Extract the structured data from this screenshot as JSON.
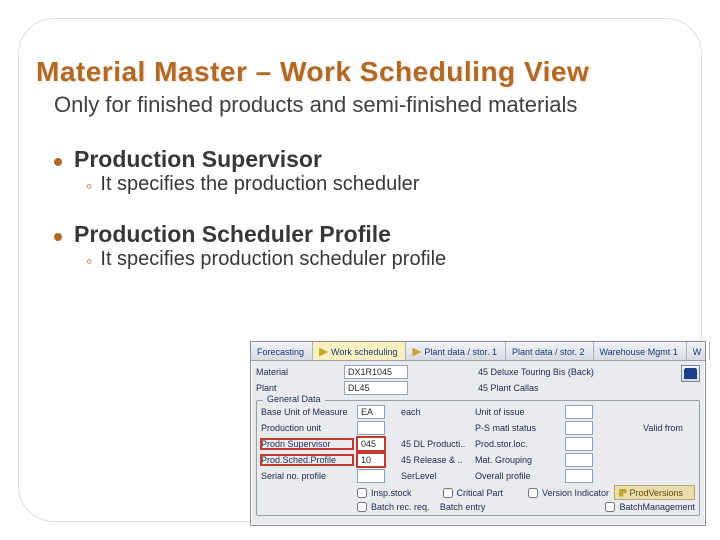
{
  "title": "Material Master – Work Scheduling View",
  "subtitle": "Only for finished products and semi-finished materials",
  "bullets": [
    {
      "heading": "Production Supervisor",
      "sub": "It specifies the production scheduler"
    },
    {
      "heading": "Production Scheduler Profile",
      "sub": "It specifies production scheduler profile"
    }
  ],
  "sap": {
    "tabs": [
      "Forecasting",
      "Work scheduling",
      "Plant data / stor. 1",
      "Plant data / stor. 2",
      "Warehouse Mgmt 1",
      "W"
    ],
    "header": {
      "material_lbl": "Material",
      "material_val": "DX1R1045",
      "material_desc": "45 Deluxe Touring Bis (Back)",
      "plant_lbl": "Plant",
      "plant_val": "DL45",
      "plant_desc": "45 Plant Callas"
    },
    "general": {
      "title": "General Data",
      "rows": {
        "buom_lbl": "Base Unit of Measure",
        "buom_val": "EA",
        "buom_desc": "each",
        "uoi_lbl": "Unit of issue",
        "produnit_lbl": "Production unit",
        "psmat_lbl": "P-S matl status",
        "valid_lbl": "Valid from",
        "supv_lbl": "Prodn Supervisor",
        "supv_val": "045",
        "supv_desc": "45 DL Producti..",
        "storloc_lbl": "Prod.stor.loc.",
        "psp_lbl": "Prod.Sched.Profile",
        "psp_val": "10",
        "psp_desc": "45 Release & ..",
        "matgrp_lbl": "Mat. Grouping",
        "serial_lbl": "Serial no. profile",
        "serlevel_lbl": "SerLevel",
        "ovprof_lbl": "Overall profile"
      },
      "checks": {
        "insp": "Insp.stock",
        "crit": "Critical Part",
        "ver": "Version Indicator",
        "batchrec": "Batch rec. req.",
        "batchentry": "Batch entry",
        "prodver": "ProdVersions",
        "batchmgmt": "BatchManagement"
      }
    }
  }
}
